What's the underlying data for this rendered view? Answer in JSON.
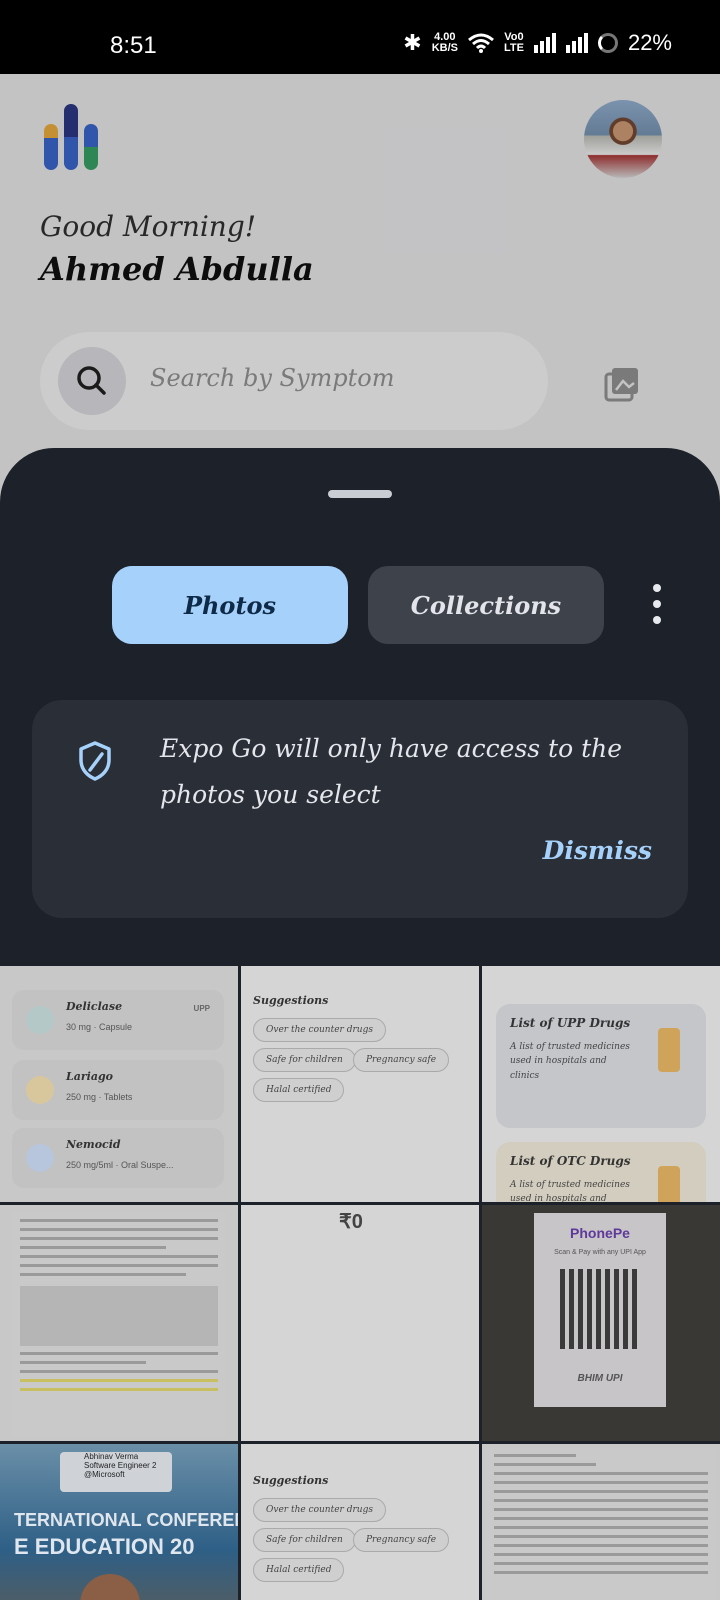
{
  "status_bar": {
    "time": "8:51",
    "net_speed": "4.00",
    "net_unit": "KB/S",
    "volte_top": "Vo0",
    "volte_bottom": "LTE",
    "battery": "22%"
  },
  "background": {
    "greeting": "Good Morning!",
    "user_name": "Ahmed Abdulla",
    "search_placeholder": "Search by Symptom"
  },
  "sheet": {
    "tabs": [
      {
        "label": "Photos",
        "selected": true
      },
      {
        "label": "Collections",
        "selected": false
      }
    ],
    "notice": {
      "text": "Expo Go will only have access to the photos you select",
      "dismiss_label": "Dismiss"
    }
  },
  "thumbnails": {
    "meds": [
      {
        "name": "Deliclase",
        "detail": "30 mg · Capsule",
        "tag": "UPP"
      },
      {
        "name": "Lariago",
        "detail": "250 mg · Tablets",
        "tag": ""
      },
      {
        "name": "Nemocid",
        "detail": "250 mg/5ml · Oral Suspe...",
        "tag": ""
      }
    ],
    "suggestions": {
      "title": "Suggestions",
      "chips": [
        "Over the counter drugs",
        "Safe for children",
        "Pregnancy safe",
        "Halal certified"
      ]
    },
    "lists": [
      {
        "title": "List of UPP Drugs",
        "desc": "A list of trusted medicines used in hospitals and clinics"
      },
      {
        "title": "List of OTC Drugs",
        "desc": "A list of trusted medicines used in hospitals and clinics"
      }
    ],
    "rupee": "₹0",
    "phonepe": {
      "title": "PhonePe",
      "subtitle": "Scan & Pay with any UPI App",
      "footer": "BHIM UPI"
    },
    "conference": {
      "person": "Abhinav Verma",
      "role": "Software Engineer 2",
      "company": "@Microsoft",
      "banner": "TERNATIONAL CONFERENCE O",
      "banner2": "E EDUCATION 20"
    }
  }
}
